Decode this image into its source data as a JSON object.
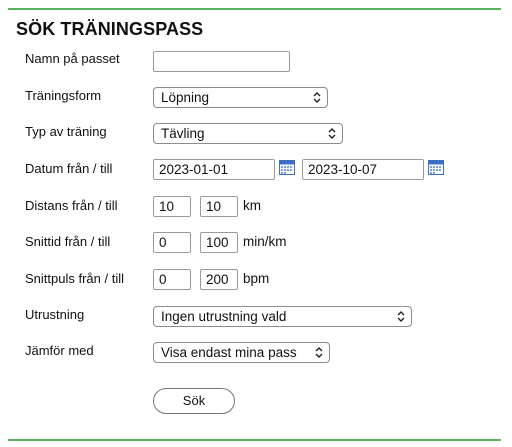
{
  "title": "SÖK TRÄNINGSPASS",
  "fields": {
    "name": {
      "label": "Namn på passet",
      "value": ""
    },
    "training_form": {
      "label": "Träningsform",
      "value": "Löpning"
    },
    "training_type": {
      "label": "Typ av träning",
      "value": "Tävling"
    },
    "date": {
      "label": "Datum från / till",
      "from": "2023-01-01",
      "to": "2023-10-07"
    },
    "distance": {
      "label": "Distans från / till",
      "from": "10",
      "to": "10",
      "unit": "km"
    },
    "pace": {
      "label": "Snittid från / till",
      "from": "0",
      "to": "100",
      "unit": "min/km"
    },
    "heart_rate": {
      "label": "Snittpuls från / till",
      "from": "0",
      "to": "200",
      "unit": "bpm"
    },
    "equipment": {
      "label": "Utrustning",
      "value": "Ingen utrustning vald"
    },
    "compare": {
      "label": "Jämför med",
      "value": "Visa endast mina pass"
    }
  },
  "search_button": "Sök",
  "colors": {
    "accent_rule": "#5bb35b",
    "calendar_icon": "#3f6fc4"
  },
  "icons": {
    "select_arrow": "chevron-up-down-icon",
    "date_picker": "calendar-icon"
  }
}
